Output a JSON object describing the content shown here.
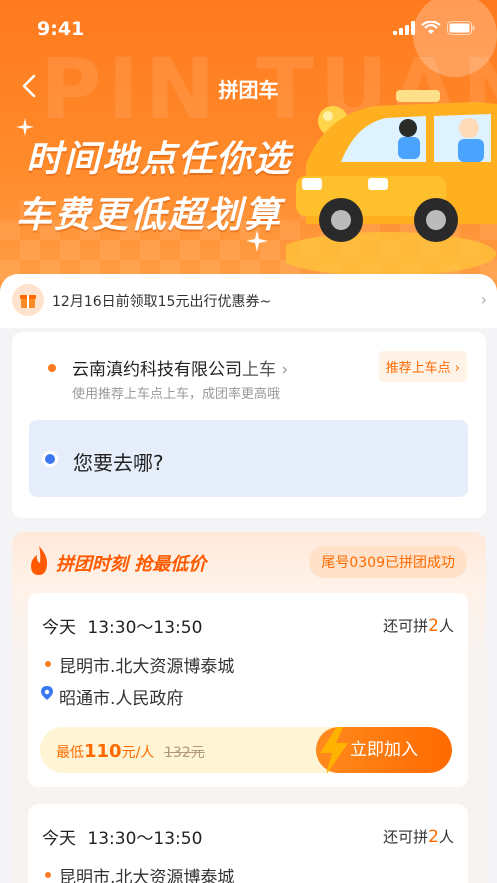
{
  "status_bar": {
    "time": "9:41"
  },
  "nav": {
    "title": "拼团车"
  },
  "banner": {
    "line1": "时间地点任你选",
    "line2": "车费更低超划算",
    "bg_text": "PIN TUAN"
  },
  "coupon": {
    "text": "12月16日前领取15元出行优惠券~"
  },
  "pickup": {
    "place": "云南滇约科技有限公司",
    "suffix": "上车",
    "hint": "使用推荐上车点上车，成团率更高哦",
    "recommend_label": "推荐上车点"
  },
  "destination": {
    "placeholder": "您要去哪?"
  },
  "group": {
    "title": "拼团时刻 抢最低价",
    "success_tag": "尾号0309已拼团成功"
  },
  "trips": [
    {
      "day": "今天",
      "time_range": "13:30～13:50",
      "seats_prefix": "还可拼",
      "seats": "2",
      "seats_suffix": "人",
      "from": "昆明市.北大资源博泰城",
      "to": "昭通市.人民政府",
      "low_label": "最低",
      "price": "110",
      "price_unit": "元/人",
      "original": "132元",
      "join_label": "立即加入"
    },
    {
      "day": "今天",
      "time_range": "13:30～13:50",
      "seats_prefix": "还可拼",
      "seats": "2",
      "seats_suffix": "人",
      "from": "昆明市.北大资源博泰城"
    }
  ],
  "colors": {
    "brand_orange": "#ff7a1e",
    "accent_blue": "#3a78f2",
    "dest_bg": "#e6eefc"
  }
}
